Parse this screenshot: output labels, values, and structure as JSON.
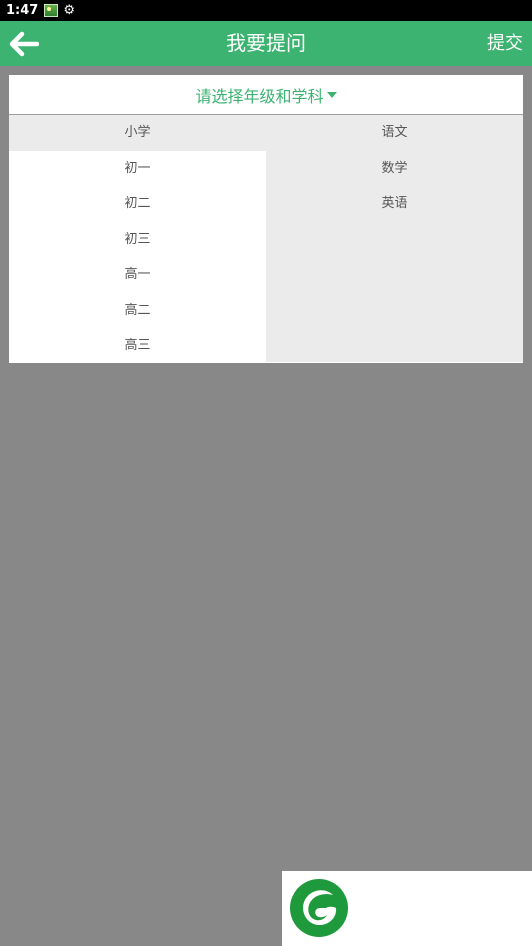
{
  "status_bar": {
    "time": "1:47"
  },
  "app_bar": {
    "title": "我要提问",
    "submit_label": "提交"
  },
  "selector": {
    "label": "请选择年级和学科"
  },
  "grades": [
    "小学",
    "初一",
    "初二",
    "初三",
    "高一",
    "高二",
    "高三"
  ],
  "subjects": [
    "语文",
    "数学",
    "英语"
  ],
  "selected_grade": "小学",
  "colors": {
    "primary": "#3cb371",
    "overlay": "#888888",
    "selected_bg": "#ebebeb"
  },
  "icons": [
    "back-arrow-icon",
    "image-notification-icon",
    "settings-gear-icon",
    "app-logo-icon"
  ]
}
